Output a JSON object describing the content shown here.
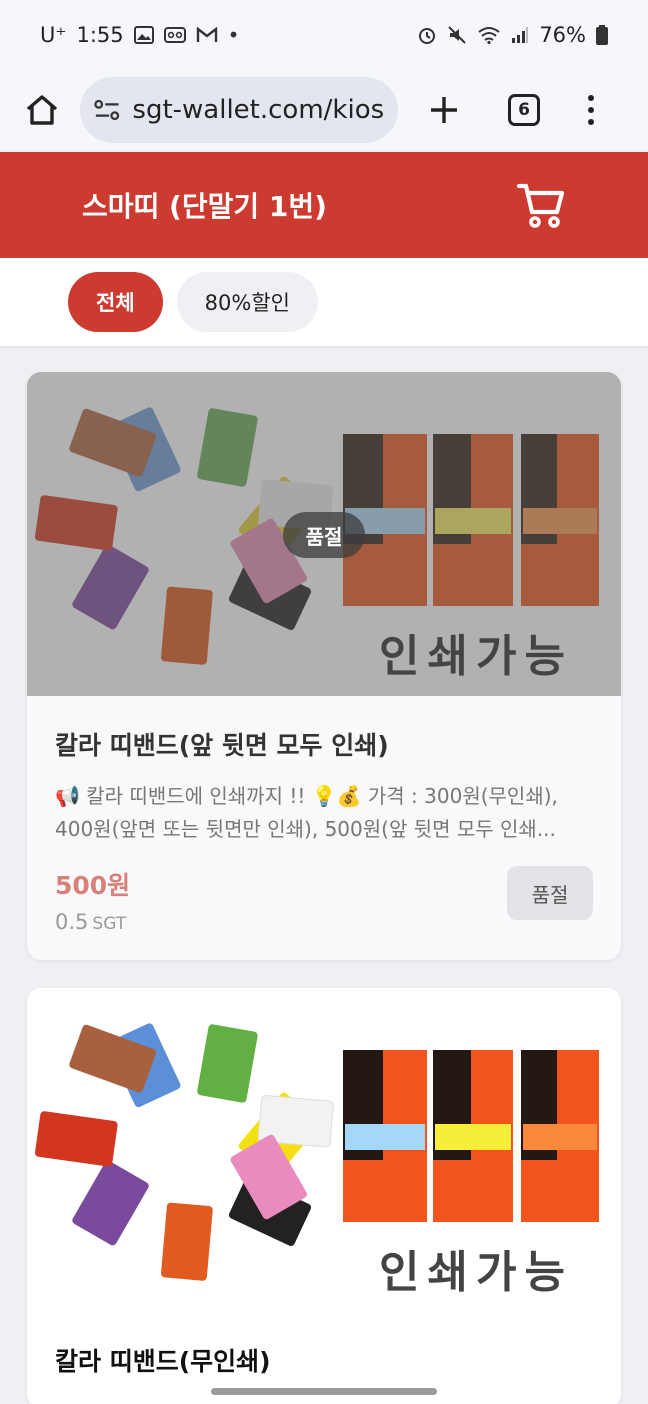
{
  "status_bar": {
    "time": "1:55",
    "carrier": "U⁺",
    "battery": "76%"
  },
  "browser": {
    "url": "sgt-wallet.com/kiosk",
    "tab_count": "6"
  },
  "header": {
    "title": "스마띠 (단말기 1번)"
  },
  "filters": [
    {
      "label": "전체",
      "active": true
    },
    {
      "label": "80%할인",
      "active": false
    }
  ],
  "products": [
    {
      "name": "칼라 띠밴드(앞 뒷면 모두 인쇄)",
      "description": "📢 칼라 띠밴드에 인쇄까지 !! 💡💰 가격 : 300원(무인쇄), 400원(앞면 또는 뒷면만 인쇄), 500원(앞 뒷면 모두 인쇄...",
      "price": "500원",
      "sgt_amount": "0.5",
      "sgt_unit": "SGT",
      "sold_out_overlay": "품절",
      "sold_out_button": "품절",
      "image_caption": "인쇄가능"
    },
    {
      "name": "칼라 띠밴드(무인쇄)",
      "image_caption": "인쇄가능"
    }
  ],
  "colors": {
    "brand_red": "#cc3a30",
    "price_red": "#d9807a"
  }
}
